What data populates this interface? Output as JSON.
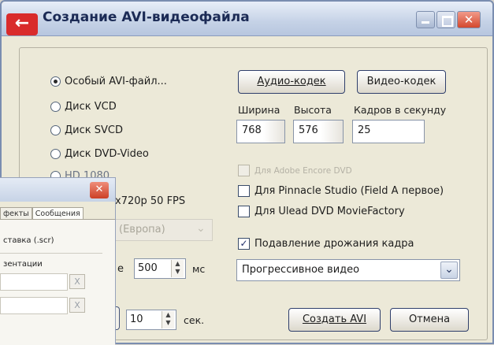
{
  "window": {
    "title": "Создание AVI-видеофайла",
    "close_glyph": "✕",
    "back_glyph": "←"
  },
  "profiles": [
    {
      "label": "Особый AVI-файл...",
      "selected": true
    },
    {
      "label": "Диск VCD",
      "selected": false
    },
    {
      "label": "Диск SVCD",
      "selected": false
    },
    {
      "label": "Диск DVD-Video",
      "selected": false
    },
    {
      "label": "HD 1080",
      "selected": false
    }
  ],
  "profile_hd720": "x720p 50 FPS",
  "region_select": {
    "value": "(Европа)"
  },
  "codecs": {
    "audio_label": "Аудио-кодек",
    "video_label": "Видео-кодек"
  },
  "dimensions": {
    "width_label": "Ширина",
    "height_label": "Высота",
    "fps_label": "Кадров в секунду",
    "width_value": "768",
    "height_value": "576",
    "fps_value": "25"
  },
  "options": [
    {
      "label": "Для Adobe Encore DVD",
      "checked": false,
      "disabled": true
    },
    {
      "label": "Для Pinnacle Studio (Field A первое)",
      "checked": false,
      "disabled": false
    },
    {
      "label": "Для Ulead DVD MovieFactory",
      "checked": false,
      "disabled": false
    },
    {
      "label": "Подавление дрожания кадра",
      "checked": true,
      "disabled": false
    }
  ],
  "check_glyph": "✓",
  "interval": {
    "prefix": "е",
    "value": "500",
    "unit": "мс"
  },
  "scan_mode": {
    "value": "Прогрессивное видео"
  },
  "duration": {
    "value": "10",
    "unit": "сек."
  },
  "actions": {
    "create_label": "Создать AVI",
    "cancel_label": "Отмена"
  },
  "spin_up": "▲",
  "spin_down": "▼",
  "dropdown_glyph": "⌄",
  "background_dialog": {
    "close_glyph": "✕",
    "tabs": [
      "фекты",
      "Сообщения"
    ],
    "rows": [
      "ставка (.scr)",
      "зентации"
    ],
    "x_glyph": "X"
  },
  "colors": {
    "titlebar": "#c5d2e6",
    "back_button": "#d92b2b",
    "close_button": "#d4482e"
  }
}
